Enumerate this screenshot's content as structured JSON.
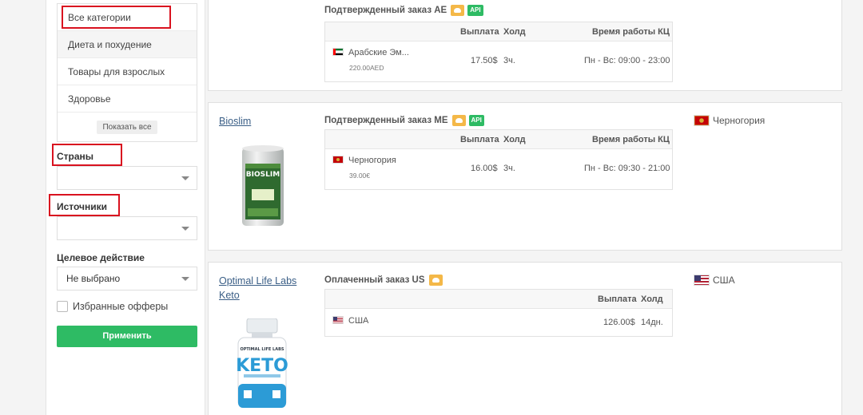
{
  "sidebar": {
    "categories": [
      {
        "label": "Все категории"
      },
      {
        "label": "Диета и похудение"
      },
      {
        "label": "Товары для взрослых"
      },
      {
        "label": "Здоровье"
      }
    ],
    "show_all": "Показать все",
    "countries_label": "Страны",
    "countries_value": "",
    "sources_label": "Источники",
    "sources_value": "",
    "target_action_label": "Целевое действие",
    "target_action_value": "Не выбрано",
    "favorites_label": "Избранные офферы",
    "apply_label": "Применить"
  },
  "offers": [
    {
      "name": "",
      "goal": "Подтвержденный заказ AE",
      "api": "API",
      "headers": {
        "payout": "Выплата",
        "hold": "Холд",
        "hours": "Время работы КЦ"
      },
      "country": "Арабские Эм...",
      "price": "220.00AED",
      "payout": "17.50$",
      "hold": "3ч.",
      "hours": "Пн - Вс: 09:00 - 23:00",
      "geo": ""
    },
    {
      "name": "Bioslim",
      "goal": "Подтвержденный заказ ME",
      "api": "API",
      "headers": {
        "payout": "Выплата",
        "hold": "Холд",
        "hours": "Время работы КЦ"
      },
      "country": "Черногория",
      "price": "39.00€",
      "payout": "16.00$",
      "hold": "3ч.",
      "hours": "Пн - Вс: 09:30 - 21:00",
      "geo": "Черногория"
    },
    {
      "name": "Optimal Life Labs Keto",
      "goal": "Оплаченный заказ US",
      "headers": {
        "payout": "Выплата",
        "hold": "Холд"
      },
      "country": "США",
      "payout": "126.00$",
      "hold": "14дн.",
      "geo": "США"
    }
  ],
  "product_images": {
    "bioslim_label": "BIOSLIM",
    "keto_brand": "OPTIMAL LIFE LABS",
    "keto_label": "KETO"
  },
  "colors": {
    "accent_green": "#2ebb64",
    "link_blue": "#3a5e86",
    "highlight_red": "#d9121f",
    "badge_orange": "#f4b848"
  }
}
